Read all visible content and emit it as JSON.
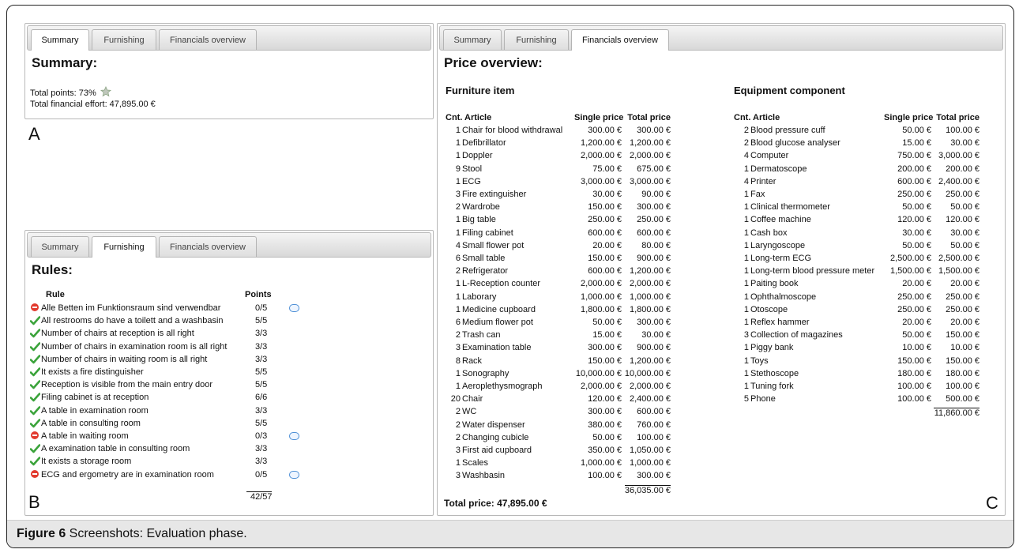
{
  "tabs": [
    "Summary",
    "Furnishing",
    "Financials overview"
  ],
  "panelA": {
    "title": "Summary:",
    "total_points": "Total points: 73%",
    "total_effort": "Total financial effort: 47,895.00 €",
    "letter": "A"
  },
  "panelB": {
    "title": "Rules:",
    "col_rule": "Rule",
    "col_points": "Points",
    "letter": "B",
    "total": "42/57",
    "rules": [
      {
        "status": "fail",
        "text": "Alle Betten im Funktionsraum sind verwendbar",
        "points": "0/5",
        "comment": true
      },
      {
        "status": "ok",
        "text": "All restrooms do have a toilett and a washbasin",
        "points": "5/5",
        "comment": false
      },
      {
        "status": "ok",
        "text": "Number of chairs at reception is all right",
        "points": "3/3",
        "comment": false
      },
      {
        "status": "ok",
        "text": "Number of chairs in examination room is all right",
        "points": "3/3",
        "comment": false
      },
      {
        "status": "ok",
        "text": "Number of chairs in waiting room is all right",
        "points": "3/3",
        "comment": false
      },
      {
        "status": "ok",
        "text": "It exists a fire distinguisher",
        "points": "5/5",
        "comment": false
      },
      {
        "status": "ok",
        "text": "Reception is visible from the main entry door",
        "points": "5/5",
        "comment": false
      },
      {
        "status": "ok",
        "text": "Filing cabinet is at reception",
        "points": "6/6",
        "comment": false
      },
      {
        "status": "ok",
        "text": "A table in examination room",
        "points": "3/3",
        "comment": false
      },
      {
        "status": "ok",
        "text": "A table in consulting room",
        "points": "5/5",
        "comment": false
      },
      {
        "status": "fail",
        "text": "A table in waiting room",
        "points": "0/3",
        "comment": true
      },
      {
        "status": "ok",
        "text": "A examination table in consulting room",
        "points": "3/3",
        "comment": false
      },
      {
        "status": "ok",
        "text": "It exists a storage room",
        "points": "3/3",
        "comment": false
      },
      {
        "status": "fail",
        "text": "ECG and ergometry are in examination room",
        "points": "0/5",
        "comment": true
      }
    ]
  },
  "panelC": {
    "title": "Price overview:",
    "letter": "C",
    "total_price": "Total price: 47,895.00 €",
    "furniture": {
      "heading": "Furniture item",
      "cols": [
        "Cnt.",
        "Article",
        "Single price",
        "Total price"
      ],
      "subtotal": "36,035.00 €",
      "items": [
        [
          "1",
          "Chair for blood withdrawal",
          "300.00 €",
          "300.00 €"
        ],
        [
          "1",
          "Defibrillator",
          "1,200.00 €",
          "1,200.00 €"
        ],
        [
          "1",
          "Doppler",
          "2,000.00 €",
          "2,000.00 €"
        ],
        [
          "9",
          "Stool",
          "75.00 €",
          "675.00 €"
        ],
        [
          "1",
          "ECG",
          "3,000.00 €",
          "3,000.00 €"
        ],
        [
          "3",
          "Fire extinguisher",
          "30.00 €",
          "90.00 €"
        ],
        [
          "2",
          "Wardrobe",
          "150.00 €",
          "300.00 €"
        ],
        [
          "1",
          "Big table",
          "250.00 €",
          "250.00 €"
        ],
        [
          "1",
          "Filing cabinet",
          "600.00 €",
          "600.00 €"
        ],
        [
          "4",
          "Small flower pot",
          "20.00 €",
          "80.00 €"
        ],
        [
          "6",
          "Small table",
          "150.00 €",
          "900.00 €"
        ],
        [
          "2",
          "Refrigerator",
          "600.00 €",
          "1,200.00 €"
        ],
        [
          "1",
          "L-Reception counter",
          "2,000.00 €",
          "2,000.00 €"
        ],
        [
          "1",
          "Laborary",
          "1,000.00 €",
          "1,000.00 €"
        ],
        [
          "1",
          "Medicine cupboard",
          "1,800.00 €",
          "1,800.00 €"
        ],
        [
          "6",
          "Medium flower pot",
          "50.00 €",
          "300.00 €"
        ],
        [
          "2",
          "Trash can",
          "15.00 €",
          "30.00 €"
        ],
        [
          "3",
          "Examination table",
          "300.00 €",
          "900.00 €"
        ],
        [
          "8",
          "Rack",
          "150.00 €",
          "1,200.00 €"
        ],
        [
          "1",
          "Sonography",
          "10,000.00 €",
          "10,000.00 €"
        ],
        [
          "1",
          "Aeroplethysmograph",
          "2,000.00 €",
          "2,000.00 €"
        ],
        [
          "20",
          "Chair",
          "120.00 €",
          "2,400.00 €"
        ],
        [
          "2",
          "WC",
          "300.00 €",
          "600.00 €"
        ],
        [
          "2",
          "Water dispenser",
          "380.00 €",
          "760.00 €"
        ],
        [
          "2",
          "Changing cubicle",
          "50.00 €",
          "100.00 €"
        ],
        [
          "3",
          "First aid cupboard",
          "350.00 €",
          "1,050.00 €"
        ],
        [
          "1",
          "Scales",
          "1,000.00 €",
          "1,000.00 €"
        ],
        [
          "3",
          "Washbasin",
          "100.00 €",
          "300.00 €"
        ]
      ]
    },
    "equipment": {
      "heading": "Equipment component",
      "cols": [
        "Cnt.",
        "Article",
        "Single price",
        "Total price"
      ],
      "subtotal": "11,860.00 €",
      "items": [
        [
          "2",
          "Blood pressure cuff",
          "50.00 €",
          "100.00 €"
        ],
        [
          "2",
          "Blood glucose analyser",
          "15.00 €",
          "30.00 €"
        ],
        [
          "4",
          "Computer",
          "750.00 €",
          "3,000.00 €"
        ],
        [
          "1",
          "Dermatoscope",
          "200.00 €",
          "200.00 €"
        ],
        [
          "4",
          "Printer",
          "600.00 €",
          "2,400.00 €"
        ],
        [
          "1",
          "Fax",
          "250.00 €",
          "250.00 €"
        ],
        [
          "1",
          "Clinical thermometer",
          "50.00 €",
          "50.00 €"
        ],
        [
          "1",
          "Coffee machine",
          "120.00 €",
          "120.00 €"
        ],
        [
          "1",
          "Cash box",
          "30.00 €",
          "30.00 €"
        ],
        [
          "1",
          "Laryngoscope",
          "50.00 €",
          "50.00 €"
        ],
        [
          "1",
          "Long-term ECG",
          "2,500.00 €",
          "2,500.00 €"
        ],
        [
          "1",
          "Long-term blood pressure meter",
          "1,500.00 €",
          "1,500.00 €"
        ],
        [
          "1",
          "Paiting book",
          "20.00 €",
          "20.00 €"
        ],
        [
          "1",
          "Ophthalmoscope",
          "250.00 €",
          "250.00 €"
        ],
        [
          "1",
          "Otoscope",
          "250.00 €",
          "250.00 €"
        ],
        [
          "1",
          "Reflex hammer",
          "20.00 €",
          "20.00 €"
        ],
        [
          "3",
          "Collection of magazines",
          "50.00 €",
          "150.00 €"
        ],
        [
          "1",
          "Piggy bank",
          "10.00 €",
          "10.00 €"
        ],
        [
          "1",
          "Toys",
          "150.00 €",
          "150.00 €"
        ],
        [
          "1",
          "Stethoscope",
          "180.00 €",
          "180.00 €"
        ],
        [
          "1",
          "Tuning fork",
          "100.00 €",
          "100.00 €"
        ],
        [
          "5",
          "Phone",
          "100.00 €",
          "500.00 €"
        ]
      ]
    }
  },
  "caption": {
    "label": "Figure 6",
    "text": " Screenshots: Evaluation phase."
  }
}
